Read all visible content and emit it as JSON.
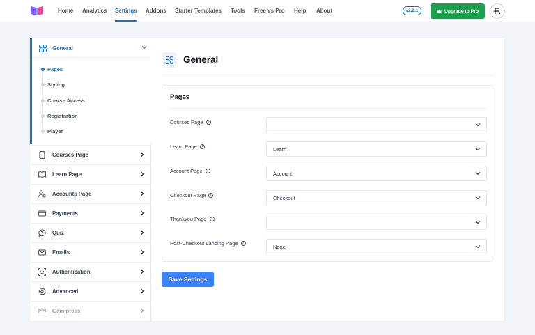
{
  "topnav": {
    "items": [
      {
        "label": "Home",
        "active": false
      },
      {
        "label": "Analytics",
        "active": false
      },
      {
        "label": "Settings",
        "active": true
      },
      {
        "label": "Addons",
        "active": false
      },
      {
        "label": "Starter Templates",
        "active": false
      },
      {
        "label": "Tools",
        "active": false
      },
      {
        "label": "Free vs Pro",
        "active": false
      },
      {
        "label": "Help",
        "active": false
      },
      {
        "label": "About",
        "active": false
      }
    ],
    "version": "v2.2.1",
    "upgrade_label": "Upgrade to Pro"
  },
  "sidebar": {
    "general": {
      "label": "General",
      "icon": "grid-icon",
      "subitems": [
        {
          "label": "Pages",
          "active": true
        },
        {
          "label": "Styling",
          "active": false
        },
        {
          "label": "Course Access",
          "active": false
        },
        {
          "label": "Registration",
          "active": false
        },
        {
          "label": "Player",
          "active": false
        }
      ]
    },
    "items": [
      {
        "label": "Courses Page",
        "icon": "tablet-icon",
        "disabled": false
      },
      {
        "label": "Learn Page",
        "icon": "book-open-icon",
        "disabled": false
      },
      {
        "label": "Accounts Page",
        "icon": "user-gear-icon",
        "disabled": false
      },
      {
        "label": "Payments",
        "icon": "credit-card-icon",
        "disabled": false
      },
      {
        "label": "Quiz",
        "icon": "chat-question-icon",
        "disabled": false
      },
      {
        "label": "Emails",
        "icon": "envelope-icon",
        "disabled": false
      },
      {
        "label": "Authentication",
        "icon": "face-scan-icon",
        "disabled": false
      },
      {
        "label": "Advanced",
        "icon": "gear-icon",
        "disabled": false
      },
      {
        "label": "Gamipress",
        "icon": "crown-icon",
        "disabled": true
      }
    ]
  },
  "main": {
    "title": "General",
    "panel_title": "Pages",
    "fields": [
      {
        "label": "Courses Page",
        "value": ""
      },
      {
        "label": "Learn Page",
        "value": "Learn"
      },
      {
        "label": "Account Page",
        "value": "Account"
      },
      {
        "label": "Checkout Page",
        "value": "Checkout"
      },
      {
        "label": "Thankyou Page",
        "value": ""
      },
      {
        "label": "Post-Checkout Landing Page",
        "value": "None"
      }
    ],
    "save_label": "Save Settings"
  },
  "colors": {
    "accent": "#2271b1",
    "upgrade_button": "#1e9e4f",
    "save_button": "#3b82f6"
  }
}
